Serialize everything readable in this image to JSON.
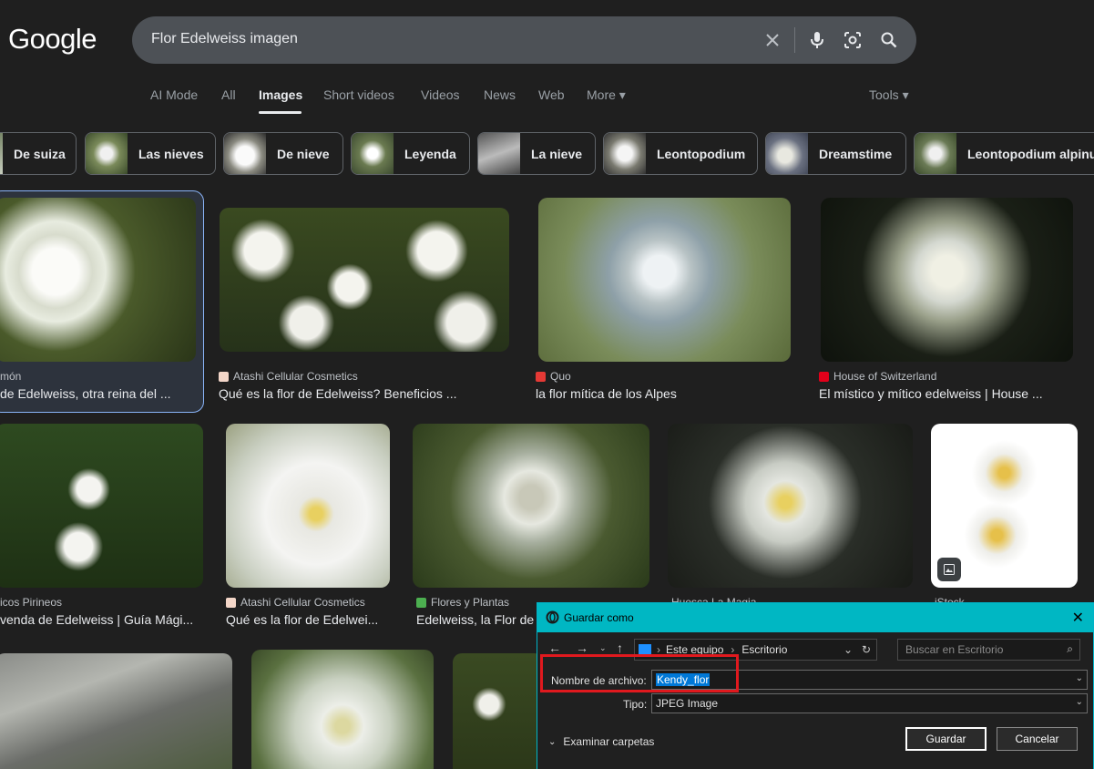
{
  "header": {
    "logo": "Google",
    "search_value": "Flor Edelweiss imagen"
  },
  "tabs": [
    {
      "label": "AI Mode"
    },
    {
      "label": "All"
    },
    {
      "label": "Images"
    },
    {
      "label": "Short videos"
    },
    {
      "label": "Videos"
    },
    {
      "label": "News"
    },
    {
      "label": "Web"
    },
    {
      "label": "More ▾"
    }
  ],
  "tools_label": "Tools ▾",
  "chips": [
    {
      "label": "De suiza"
    },
    {
      "label": "Las nieves"
    },
    {
      "label": "De nieve"
    },
    {
      "label": "Leyenda"
    },
    {
      "label": "La nieve"
    },
    {
      "label": "Leontopodium"
    },
    {
      "label": "Dreamstime"
    },
    {
      "label": "Leontopodium alpinum"
    }
  ],
  "results": [
    {
      "source": "món",
      "title": "de Edelweiss, otra reina del ..."
    },
    {
      "source": "Atashi Cellular Cosmetics",
      "title": "Qué es la flor de Edelweiss? Beneficios ..."
    },
    {
      "source": "Quo",
      "title": "la flor mítica de los Alpes"
    },
    {
      "source": "House of Switzerland",
      "title": "El místico y mítico edelweiss | House ..."
    },
    {
      "source": "icos Pirineos",
      "title": "venda de Edelweiss | Guía Mági..."
    },
    {
      "source": "Atashi Cellular Cosmetics",
      "title": "Qué es la flor de Edelwei..."
    },
    {
      "source": "Flores y Plantas",
      "title": "Edelweiss, la Flor de"
    },
    {
      "source": "Huesca La Magia",
      "title": ""
    },
    {
      "source": "iStock",
      "title": ""
    }
  ],
  "dialog": {
    "title": "Guardar como",
    "breadcrumb": [
      "Este equipo",
      "Escritorio"
    ],
    "search_placeholder": "Buscar en Escritorio",
    "filename_label": "Nombre de archivo:",
    "filename_value": "Kendy_flor",
    "type_label": "Tipo:",
    "type_value": "JPEG Image",
    "browse_label": "Examinar carpetas",
    "save_label": "Guardar",
    "cancel_label": "Cancelar"
  },
  "colors": {
    "background": "#1f1f1f",
    "dialog_title_bar": "#00b7c3",
    "highlight_box": "#e0191e",
    "selection": "#0078d7"
  }
}
